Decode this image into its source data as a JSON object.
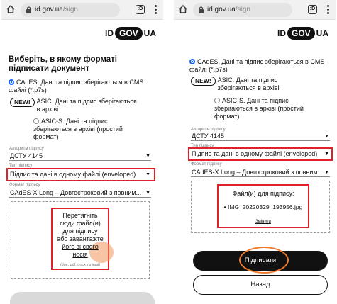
{
  "browser": {
    "host": "id.gov.ua",
    "path": "/sign",
    "tabs_count": ":D"
  },
  "logo": {
    "left": "ID",
    "pill": "GOV",
    "right": "UA"
  },
  "left": {
    "heading": "Виберіть, в якому форматі підписати документ",
    "cades": "CAdES. Дані та підпис зберігаються в CMS файлі (*.p7s)",
    "new_badge": "NEW!",
    "asic_e": "ASIC. Дані та підпис зберігаються в архіві",
    "asic_s": "ASIC-S. Дані та підпис зберігаються в архіві (простий формат)",
    "algo_label": "Алгоритм підпису",
    "algo_value": "ДСТУ 4145",
    "type_label": "Тип підпису",
    "type_value": "Підпис та дані в одному файлі (enveloped)",
    "format_label": "Формат підпису",
    "format_value": "CAdES-X Long – Довгостроковий з повним...",
    "drop_line1": "Перетягніть",
    "drop_line2": "сюди файл(и)",
    "drop_line3": "для підпису",
    "drop_line4a": "або ",
    "drop_line4b": "завантажте",
    "drop_line5": "його зі свого",
    "drop_line6": "носія",
    "drop_hint": "(doc, pdf, docx та інші)"
  },
  "right": {
    "cades": "CAdES. Дані та підпис зберігаються в CMS файлі (*.p7s)",
    "new_badge": "NEW!",
    "asic_e": "ASIC. Дані та підпис зберігаються в архіві",
    "asic_s": "ASIC-S. Дані та підпис зберігаються в архіві (простий формат)",
    "algo_label": "Алгоритм підпису",
    "algo_value": "ДСТУ 4145",
    "type_label": "Тип підпису",
    "type_value": "Підпис та дані в одному файлі (enveloped)",
    "format_label": "Формат підпису",
    "format_value": "CAdES-X Long – Довгостроковий з повним...",
    "files_title": "Файл(и) для підпису:",
    "file_name": "IMG_20220329_193956.jpg",
    "change_link": "Змінити",
    "sign_button": "Підписати",
    "back_button": "Назад"
  },
  "colors": {
    "highlight": "#e0212a",
    "accent": "#1a5ff5",
    "annotation": "#f07a2a"
  }
}
